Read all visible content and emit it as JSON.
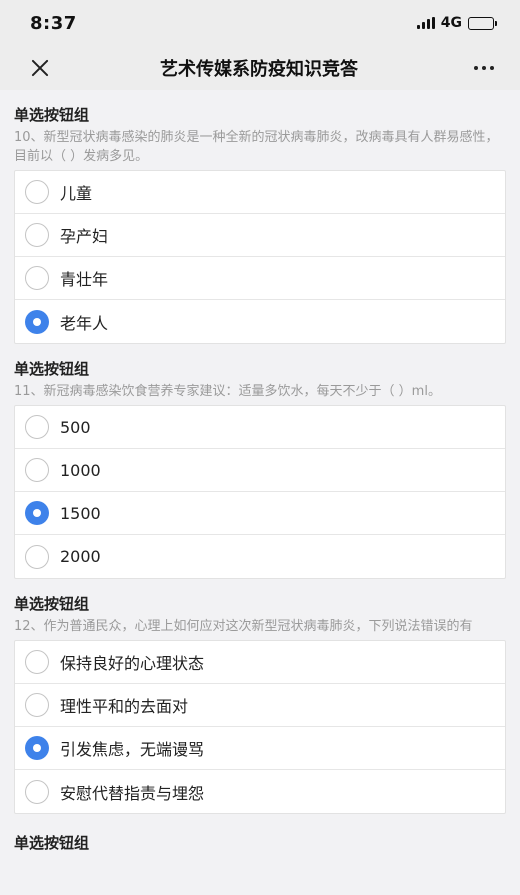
{
  "status_bar": {
    "time": "8:37",
    "network": "4G",
    "icons": [
      "signal-icon",
      "battery-icon"
    ]
  },
  "nav": {
    "close_icon": "close-icon",
    "title": "艺术传媒系防疫知识竞答",
    "more_icon": "more-icon"
  },
  "accent_color": "#3e82ea",
  "questions": [
    {
      "type_label": "单选按钮组",
      "text": "10、新型冠状病毒感染的肺炎是一种全新的冠状病毒肺炎，改病毒具有人群易感性，目前以（ ）发病多见。",
      "options": [
        {
          "label": "儿童",
          "selected": false
        },
        {
          "label": "孕产妇",
          "selected": false
        },
        {
          "label": "青壮年",
          "selected": false
        },
        {
          "label": "老年人",
          "selected": true
        }
      ]
    },
    {
      "type_label": "单选按钮组",
      "text": "11、新冠病毒感染饮食营养专家建议：适量多饮水，每天不少于（ ）ml。",
      "options": [
        {
          "label": "500",
          "selected": false
        },
        {
          "label": "1000",
          "selected": false
        },
        {
          "label": "1500",
          "selected": true
        },
        {
          "label": "2000",
          "selected": false
        }
      ]
    },
    {
      "type_label": "单选按钮组",
      "text": "12、作为普通民众，心理上如何应对这次新型冠状病毒肺炎，下列说法错误的有",
      "options": [
        {
          "label": "保持良好的心理状态",
          "selected": false
        },
        {
          "label": "理性平和的去面对",
          "selected": false
        },
        {
          "label": "引发焦虑，无端谩骂",
          "selected": true
        },
        {
          "label": "安慰代替指责与埋怨",
          "selected": false
        }
      ]
    },
    {
      "type_label": "单选按钮组"
    }
  ]
}
